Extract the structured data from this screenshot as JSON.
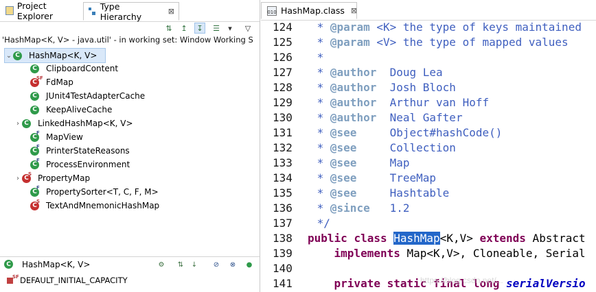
{
  "left_tabs": [
    {
      "label": "Project Explorer",
      "icon": "project-explorer-icon"
    },
    {
      "label": "Type Hierarchy",
      "icon": "type-hierarchy-icon"
    }
  ],
  "close_glyph": "⊠",
  "scope_text": "'HashMap<K, V> - java.util' - in working set: Window Working S",
  "tree": {
    "root": "HashMap<K, V>",
    "items": [
      {
        "label": "ClipboardContent",
        "expandable": false
      },
      {
        "label": "FdMap",
        "expandable": false
      },
      {
        "label": "JUnit4TestAdapterCache",
        "expandable": false
      },
      {
        "label": "KeepAliveCache",
        "expandable": false
      },
      {
        "label": "LinkedHashMap<K, V>",
        "expandable": true
      },
      {
        "label": "MapView",
        "expandable": false
      },
      {
        "label": "PrinterStateReasons",
        "expandable": false
      },
      {
        "label": "ProcessEnvironment",
        "expandable": false
      },
      {
        "label": "PropertyMap",
        "expandable": true
      },
      {
        "label": "PropertySorter<T, C, F, M>",
        "expandable": false
      },
      {
        "label": "TextAndMnemonicHashMap",
        "expandable": false
      }
    ]
  },
  "members": {
    "title": "HashMap<K, V>",
    "first_field": "DEFAULT_INITIAL_CAPACITY"
  },
  "editor": {
    "tab_label": "HashMap.class",
    "class_icon_text": "010",
    "lines": [
      {
        "n": "124",
        "text": " * @param <K> the type of keys maintained"
      },
      {
        "n": "125",
        "text": " * @param <V> the type of mapped values"
      },
      {
        "n": "126",
        "text": " *"
      },
      {
        "n": "127",
        "text": " * @author  Doug Lea"
      },
      {
        "n": "128",
        "text": " * @author  Josh Bloch"
      },
      {
        "n": "129",
        "text": " * @author  Arthur van Hoff"
      },
      {
        "n": "130",
        "text": " * @author  Neal Gafter"
      },
      {
        "n": "131",
        "text": " * @see     Object#hashCode()"
      },
      {
        "n": "132",
        "text": " * @see     Collection"
      },
      {
        "n": "133",
        "text": " * @see     Map"
      },
      {
        "n": "134",
        "text": " * @see     TreeMap"
      },
      {
        "n": "135",
        "text": " * @see     Hashtable"
      },
      {
        "n": "136",
        "text": " * @since   1.2"
      },
      {
        "n": "137",
        "text": " */"
      },
      {
        "n": "138",
        "text": "public class HashMap<K,V> extends Abstract"
      },
      {
        "n": "139",
        "text": "    implements Map<K,V>, Cloneable, Serial"
      },
      {
        "n": "140",
        "text": ""
      },
      {
        "n": "141",
        "text": "    private static final long serialVersio"
      }
    ]
  },
  "watermark": "https://blog.csdn.net/..."
}
